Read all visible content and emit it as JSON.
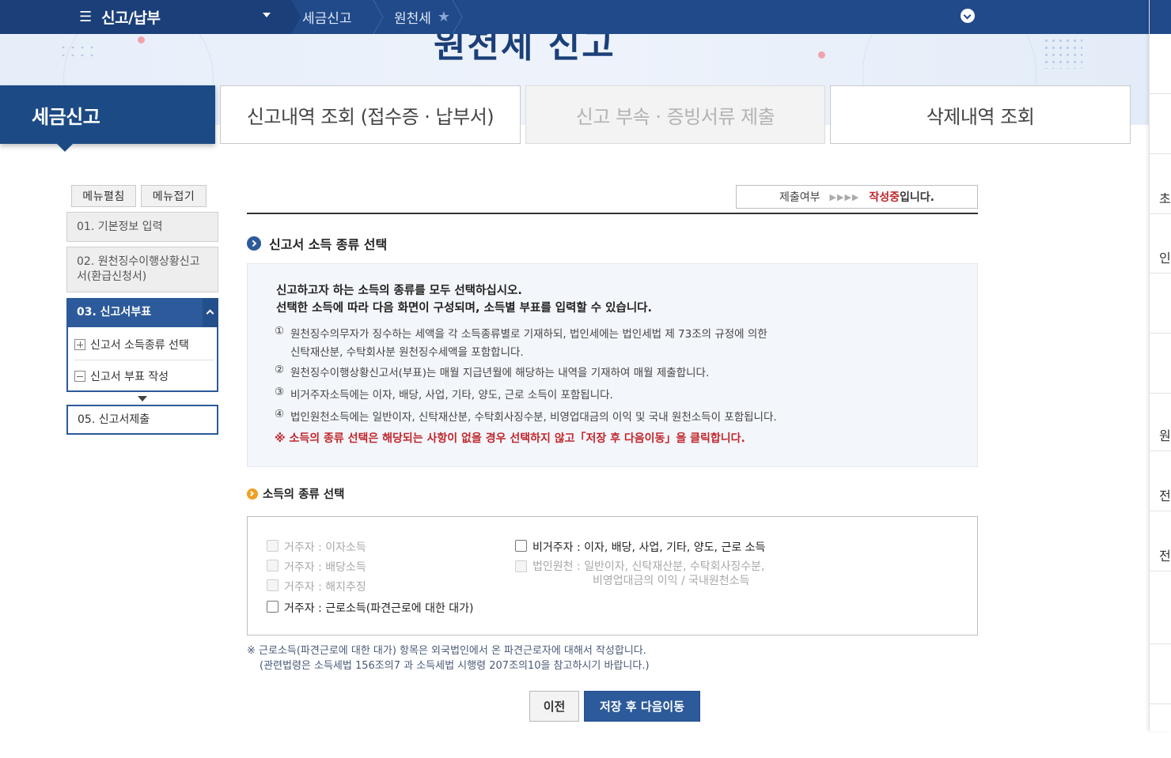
{
  "topbar": {
    "menu_icon": "hamburger-icon",
    "menu_title": "신고/납부",
    "breadcrumbs": [
      "세금신고",
      "원천세"
    ],
    "favorite_icon": "star-icon",
    "expand_icon": "chevron-down-icon"
  },
  "hero": {
    "title": "원천세 신고"
  },
  "tabs": [
    {
      "label": "세금신고",
      "state": "active"
    },
    {
      "label": "신고내역 조회 (접수증 · 납부서)",
      "state": "normal"
    },
    {
      "label": "신고 부속 · 증빙서류 제출",
      "state": "disabled"
    },
    {
      "label": "삭제내역 조회",
      "state": "normal"
    }
  ],
  "left_menu": {
    "expand_all": "메뉴펼침",
    "collapse_all": "메뉴접기",
    "items": [
      {
        "label": "01. 기본정보 입력"
      },
      {
        "label": "02. 원천징수이행상황신고서(환급신청서)"
      },
      {
        "label": "03. 신고서부표"
      },
      {
        "label": "05. 신고서제출"
      }
    ],
    "subitems": [
      {
        "label": "신고서 소득종류 선택"
      },
      {
        "label": "신고서 부표 작성"
      }
    ]
  },
  "status": {
    "label": "제출여부",
    "arrows": "▶▶▶▶",
    "value": "작성중",
    "suffix": "입니다."
  },
  "section1": {
    "title": "신고서 소득 종류 선택",
    "lead1": "신고하고자 하는 소득의 종류를 모두 선택하십시오.",
    "lead2": "선택한 소득에 따라 다음 화면이 구성되며, 소득별 부표를 입력할 수 있습니다.",
    "notes": [
      {
        "num": "①",
        "text1": "원천징수의무자가 징수하는 세액을 각 소득종류별로 기재하되, 법인세에는 법인세법 제 73조의 규정에 의한",
        "text2": "신탁재산분, 수탁회사분 원천징수세액을 포함합니다."
      },
      {
        "num": "②",
        "text1": "원천징수이행상황신고서(부표)는 매월 지급년월에 해당하는 내역을 기재하여 매월 제출합니다."
      },
      {
        "num": "③",
        "text1": "비거주자소득에는 이자, 배당, 사업, 기타, 양도, 근로 소득이 포함됩니다."
      },
      {
        "num": "④",
        "text1": "법인원천소득에는 일반이자, 신탁재산분, 수탁회사징수분, 비영업대금의 이익 및 국내 원천소득이 포함됩니다."
      }
    ],
    "warning": "※ 소득의 종류 선택은 해당되는 사항이 없을 경우 선택하지 않고「저장 후 다음이동」을 클릭합니다."
  },
  "section2": {
    "title": "소득의 종류 선택",
    "options_left": [
      {
        "label": "거주자 : 이자소득",
        "enabled": false,
        "checked": false
      },
      {
        "label": "거주자 : 배당소득",
        "enabled": false,
        "checked": false
      },
      {
        "label": "거주자 : 해지추징",
        "enabled": false,
        "checked": false
      },
      {
        "label": "거주자 : 근로소득(파견근로에 대한 대가)",
        "enabled": true,
        "checked": false
      }
    ],
    "options_right": [
      {
        "label": "비거주자 : 이자, 배당, 사업, 기타, 양도, 근로 소득",
        "enabled": true,
        "checked": false
      },
      {
        "label": "법인원천 : 일반이자, 신탁재산분, 수탁회사징수분,",
        "label2": "비영업대금의 이익 / 국내원천소득",
        "enabled": false,
        "checked": false
      }
    ]
  },
  "footnote": {
    "line1": "※ 근로소득(파견근로에 대한 대가) 항목은 외국법인에서 온 파견근로자에 대해서 작성합니다.",
    "line2": "(관련법령은 소득세법 156조의7 과 소득세법 시행령 207조의10을 참고하시기 바랍니다.)"
  },
  "buttons": {
    "prev": "이전",
    "next": "저장 후 다음이동"
  },
  "right_panel_chars": [
    "초",
    "인",
    "원",
    "전",
    "전"
  ]
}
